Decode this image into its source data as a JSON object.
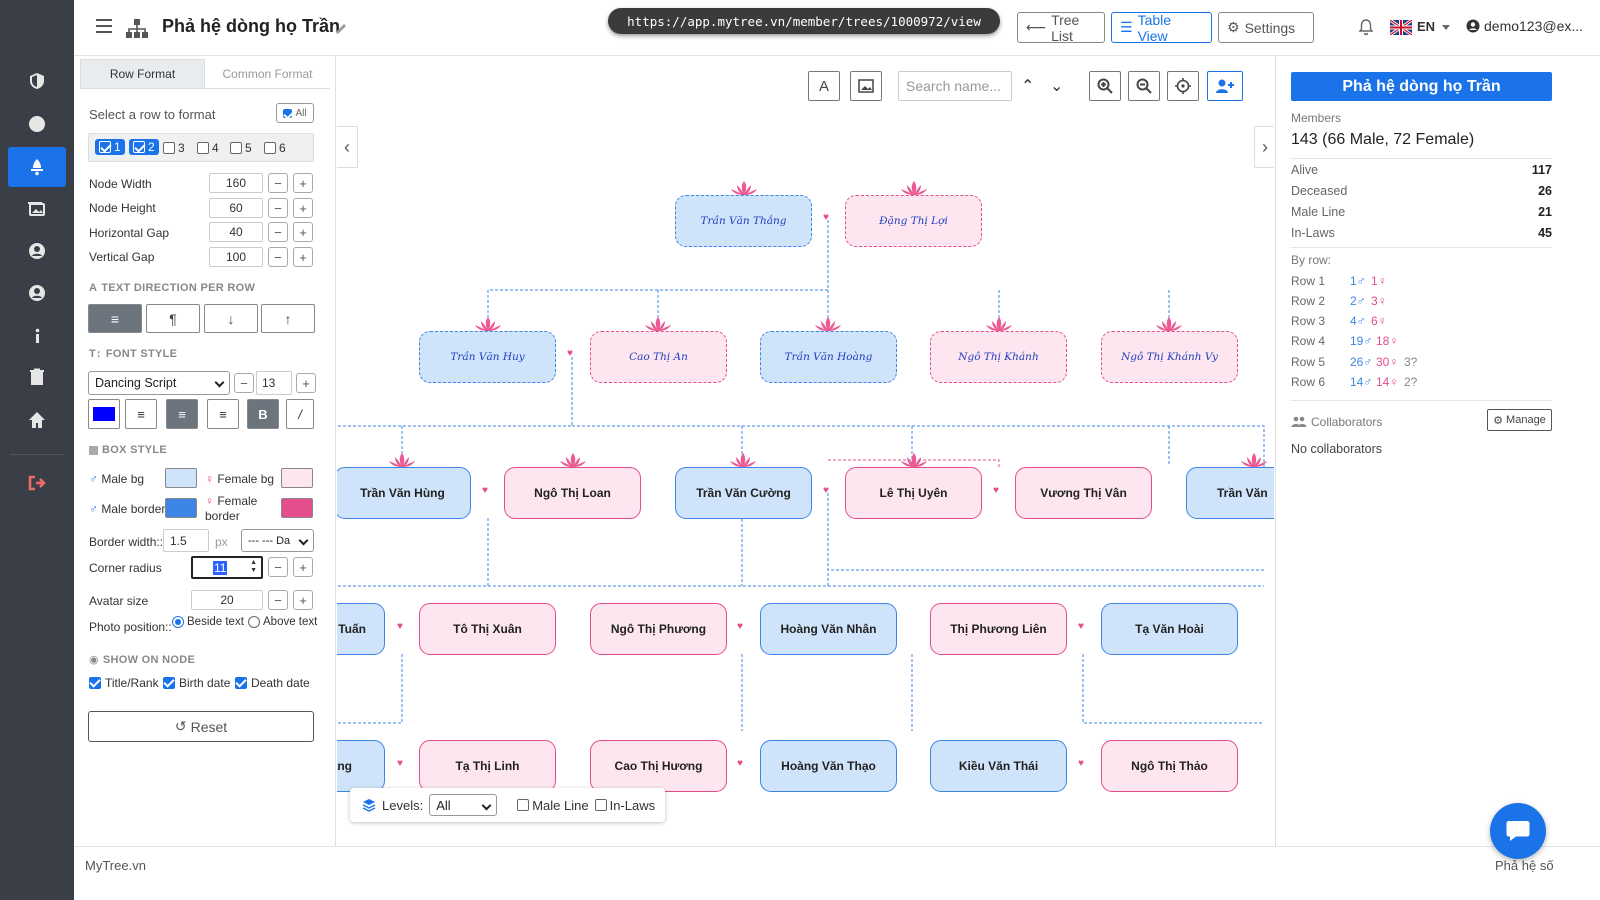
{
  "header": {
    "title": "Phả hệ dòng họ Trần",
    "url": "https://app.mytree.vn/member/trees/1000972/view",
    "tree_list": "Tree List",
    "table_view": "Table View",
    "settings": "Settings",
    "lang": "EN",
    "user": "demo123@ex..."
  },
  "format_panel": {
    "tab_row": "Row Format",
    "tab_common": "Common Format",
    "select_row": "Select a row to format",
    "all": "All",
    "rows": [
      "1",
      "2",
      "3",
      "4",
      "5",
      "6"
    ],
    "node_width_label": "Node Width",
    "node_width": "160",
    "node_height_label": "Node Height",
    "node_height": "60",
    "hgap_label": "Horizontal Gap",
    "hgap": "40",
    "vgap_label": "Vertical Gap",
    "vgap": "100",
    "text_direction": "TEXT DIRECTION PER ROW",
    "font_style": "FONT STYLE",
    "font_family": "Dancing Script",
    "font_size": "13",
    "box_style": "BOX STYLE",
    "male_bg": "Male bg",
    "female_bg": "Female bg",
    "male_border": "Male border",
    "female_border": "Female border",
    "border_width_label": "Border width::",
    "border_width": "1.5",
    "px": "px",
    "border_style": "--- --- Da",
    "corner_radius_label": "Corner radius",
    "corner_radius": "11",
    "avatar_label": "Avatar size",
    "avatar": "20",
    "photo_position": "Photo position::",
    "beside_text": "Beside text",
    "above_text": "Above text",
    "show_on_node": "SHOW ON NODE",
    "title_rank": "Title/Rank",
    "birth_date": "Birth date",
    "death_date": "Death date",
    "reset": "Reset",
    "colors": {
      "male_bg": "#cfe4fb",
      "female_bg": "#fde6ef",
      "male_border": "#3d85e4",
      "female_border": "#e44d8c",
      "font_color": "#0000ff"
    }
  },
  "canvas": {
    "search_placeholder": "Search name...",
    "levels_label": "Levels:",
    "levels_value": "All",
    "male_line": "Male Line",
    "in_laws": "In-Laws",
    "nodes": {
      "r1a": "Trần Văn Thắng",
      "r1b": "Đặng Thị Lợi",
      "r2a": "Trần Văn Huy",
      "r2b": "Cao Thị An",
      "r2c": "Trần Văn Hoàng",
      "r2d": "Ngô Thị Khánh",
      "r2e": "Ngô Thị Khánh Vy",
      "r3a": "Trần Văn Hùng",
      "r3b": "Ngô Thị Loan",
      "r3c": "Trần Văn Cường",
      "r3d": "Lê Thị Uyên",
      "r3e": "Vương Thị Vân",
      "r3f": "Trần Văn",
      "r4a": "Tuấn",
      "r4b": "Tô Thị Xuân",
      "r4c": "Ngô Thị Phương",
      "r4d": "Hoàng Văn Nhân",
      "r4e": "Thị Phương Liên",
      "r4f": "Tạ Văn Hoài",
      "r5a": "ang",
      "r5b": "Tạ Thị Linh",
      "r5c": "Cao Thị Hương",
      "r5d": "Hoàng Văn Thạo",
      "r5e": "Kiều Văn Thái",
      "r5f": "Ngô Thị Thảo"
    }
  },
  "info_panel": {
    "title": "Phả hệ dòng họ Trần",
    "members_label": "Members",
    "members": "143 (66 Male, 72 Female)",
    "alive_label": "Alive",
    "alive": "117",
    "deceased_label": "Deceased",
    "deceased": "26",
    "male_line_label": "Male Line",
    "male_line": "21",
    "in_laws_label": "In-Laws",
    "in_laws": "45",
    "by_row": "By row:",
    "rows": [
      {
        "label": "Row 1",
        "male": "1♂",
        "female": "1♀",
        "unknown": ""
      },
      {
        "label": "Row 2",
        "male": "2♂",
        "female": "3♀",
        "unknown": ""
      },
      {
        "label": "Row 3",
        "male": "4♂",
        "female": "6♀",
        "unknown": ""
      },
      {
        "label": "Row 4",
        "male": "19♂",
        "female": "18♀",
        "unknown": ""
      },
      {
        "label": "Row 5",
        "male": "26♂",
        "female": "30♀",
        "unknown": "3?"
      },
      {
        "label": "Row 6",
        "male": "14♂",
        "female": "14♀",
        "unknown": "2?"
      }
    ],
    "collaborators": "Collaborators",
    "manage": "Manage",
    "no_collaborators": "No collaborators"
  },
  "footer": {
    "brand": "MyTree.vn",
    "right": "Phả hệ số"
  }
}
